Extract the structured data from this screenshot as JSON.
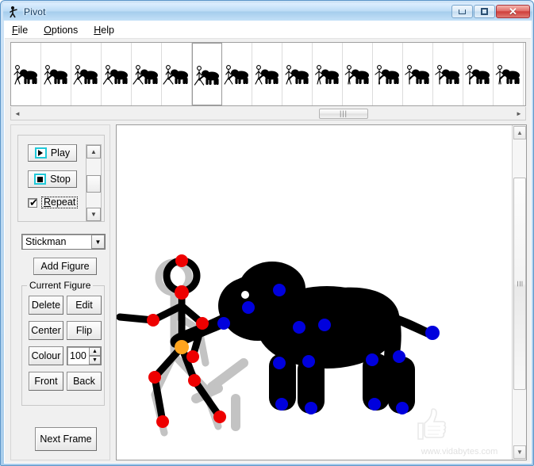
{
  "window": {
    "title": "Pivot",
    "icon": "stickman-icon",
    "controls": {
      "minimize": "minimize-icon",
      "maximize": "maximize-icon",
      "close": "✕"
    }
  },
  "menubar": {
    "items": [
      {
        "label": "File",
        "mnemonic": "F",
        "rest": "ile"
      },
      {
        "label": "Options",
        "mnemonic": "O",
        "rest": "ptions"
      },
      {
        "label": "Help",
        "mnemonic": "H",
        "rest": "elp"
      }
    ]
  },
  "framestrip": {
    "frame_count": 18,
    "selected_index": 6,
    "scrollbar": {
      "left_arrow": "◄",
      "right_arrow": "►",
      "thumb_grip": "|||"
    }
  },
  "controls": {
    "play": {
      "label": "Play",
      "icon": "play-icon"
    },
    "stop": {
      "label": "Stop",
      "icon": "stop-icon"
    },
    "repeat": {
      "label": "Repeat",
      "mnemonic": "R",
      "rest": "epeat",
      "checked": true,
      "tick": "✔"
    },
    "speed_scrollbar": {
      "up_arrow": "▲",
      "down_arrow": "▼"
    },
    "figure_select": {
      "value": "Stickman",
      "arrow": "▼"
    },
    "add_figure": {
      "label": "Add Figure"
    }
  },
  "current_figure": {
    "legend": "Current Figure",
    "buttons": [
      {
        "label": "Delete"
      },
      {
        "label": "Edit"
      },
      {
        "label": "Center"
      },
      {
        "label": "Flip"
      },
      {
        "label": "Colour"
      },
      {
        "label": "Front"
      },
      {
        "label": "Back"
      }
    ],
    "spinner": {
      "value": "100",
      "up": "▲",
      "down": "▼"
    }
  },
  "next_frame": {
    "label": "Next Frame"
  },
  "canvas": {
    "background": "#ffffff",
    "watermark": {
      "text": "www.vidabytes.com",
      "icon": "thumbs-up-icon"
    },
    "scrollbar": {
      "up_arrow": "▲",
      "down_arrow": "▼",
      "thumb_grip": "☰"
    },
    "figures": [
      {
        "name": "stickman",
        "limb_color": "#000000",
        "joint_color": "#ee0000",
        "center_joint_color": "#ffa41e",
        "ghost_color": "#c3c3c3"
      },
      {
        "name": "elephant",
        "body_color": "#000000",
        "joint_color": "#0000dd",
        "eye_color": "#ffffff",
        "ghost_color": "#c3c3c3"
      }
    ]
  },
  "colors": {
    "accent": "#5d96c9",
    "panel": "#f0f0f0",
    "close_button": "#cf3f3c",
    "play_icon_border": "#20c8d8"
  }
}
